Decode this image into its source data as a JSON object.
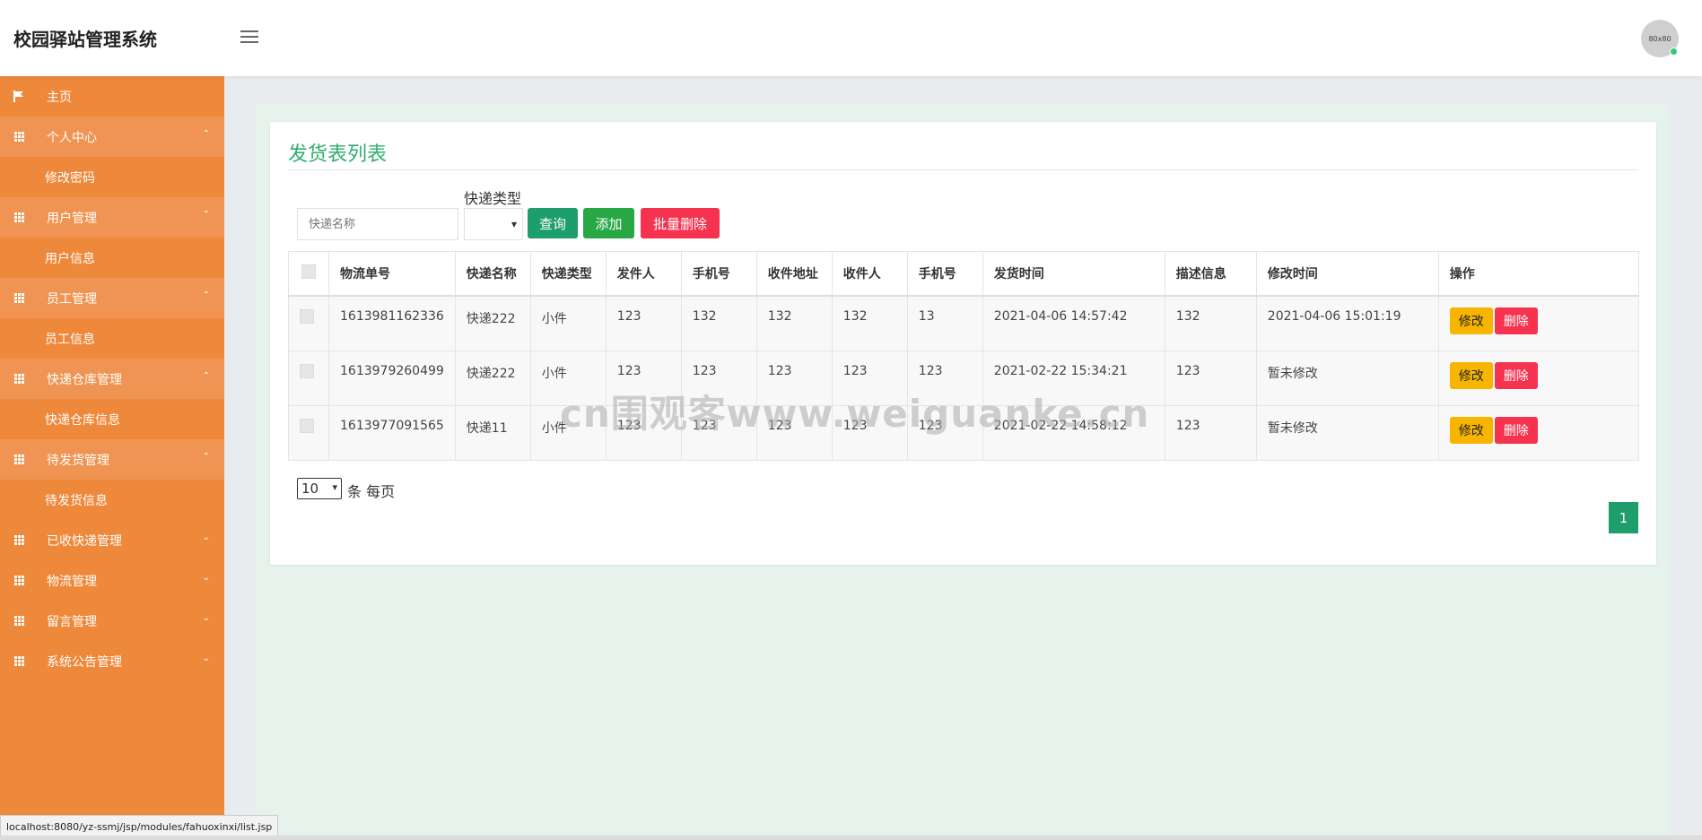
{
  "header": {
    "brand": "校园驿站管理系统",
    "avatar_text": "80x80"
  },
  "sidebar": {
    "home": "主页",
    "groups": [
      {
        "label": "个人中心",
        "sub": "修改密码"
      },
      {
        "label": "用户管理",
        "sub": "用户信息"
      },
      {
        "label": "员工管理",
        "sub": "员工信息"
      },
      {
        "label": "快递仓库管理",
        "sub": "快递仓库信息"
      },
      {
        "label": "待发货管理",
        "sub": "待发货信息"
      },
      {
        "label": "已收快递管理"
      },
      {
        "label": "物流管理"
      },
      {
        "label": "留言管理"
      },
      {
        "label": "系统公告管理"
      }
    ]
  },
  "main": {
    "title": "发货表列表",
    "search": {
      "placeholder": "快递名称",
      "type_label": "快递类型",
      "type_value": ""
    },
    "buttons": {
      "query": "查询",
      "add": "添加",
      "bulk_delete": "批量删除"
    },
    "table": {
      "columns": [
        "物流单号",
        "快递名称",
        "快递类型",
        "发件人",
        "手机号",
        "收件地址",
        "收件人",
        "手机号",
        "发货时间",
        "描述信息",
        "修改时间",
        "操作"
      ],
      "rows": [
        [
          "1613981162336",
          "快递222",
          "小件",
          "123",
          "132",
          "132",
          "132",
          "13",
          "2021-04-06 14:57:42",
          "132",
          "2021-04-06 15:01:19"
        ],
        [
          "1613979260499",
          "快递222",
          "小件",
          "123",
          "123",
          "123",
          "123",
          "123",
          "2021-02-22 15:34:21",
          "123",
          "暂未修改"
        ],
        [
          "1613977091565",
          "快递11",
          "小件",
          "123",
          "123",
          "123",
          "123",
          "123",
          "2021-02-22 14:58:12",
          "123",
          "暂未修改"
        ]
      ],
      "edit_label": "修改",
      "delete_label": "删除"
    },
    "pagination": {
      "page_size": "10",
      "per_page_label": "条 每页",
      "current_page": "1"
    }
  },
  "watermark": "cn围观客www.weiguanke.cn",
  "statusbar": {
    "url": "localhost:8080/yz-ssmj/jsp/modules/fahuoxinxi/list.jsp"
  },
  "colors": {
    "sidebar": "#ee883b",
    "accent_green": "#2eaf6e",
    "danger": "#f5334f",
    "warning": "#f7b500"
  }
}
